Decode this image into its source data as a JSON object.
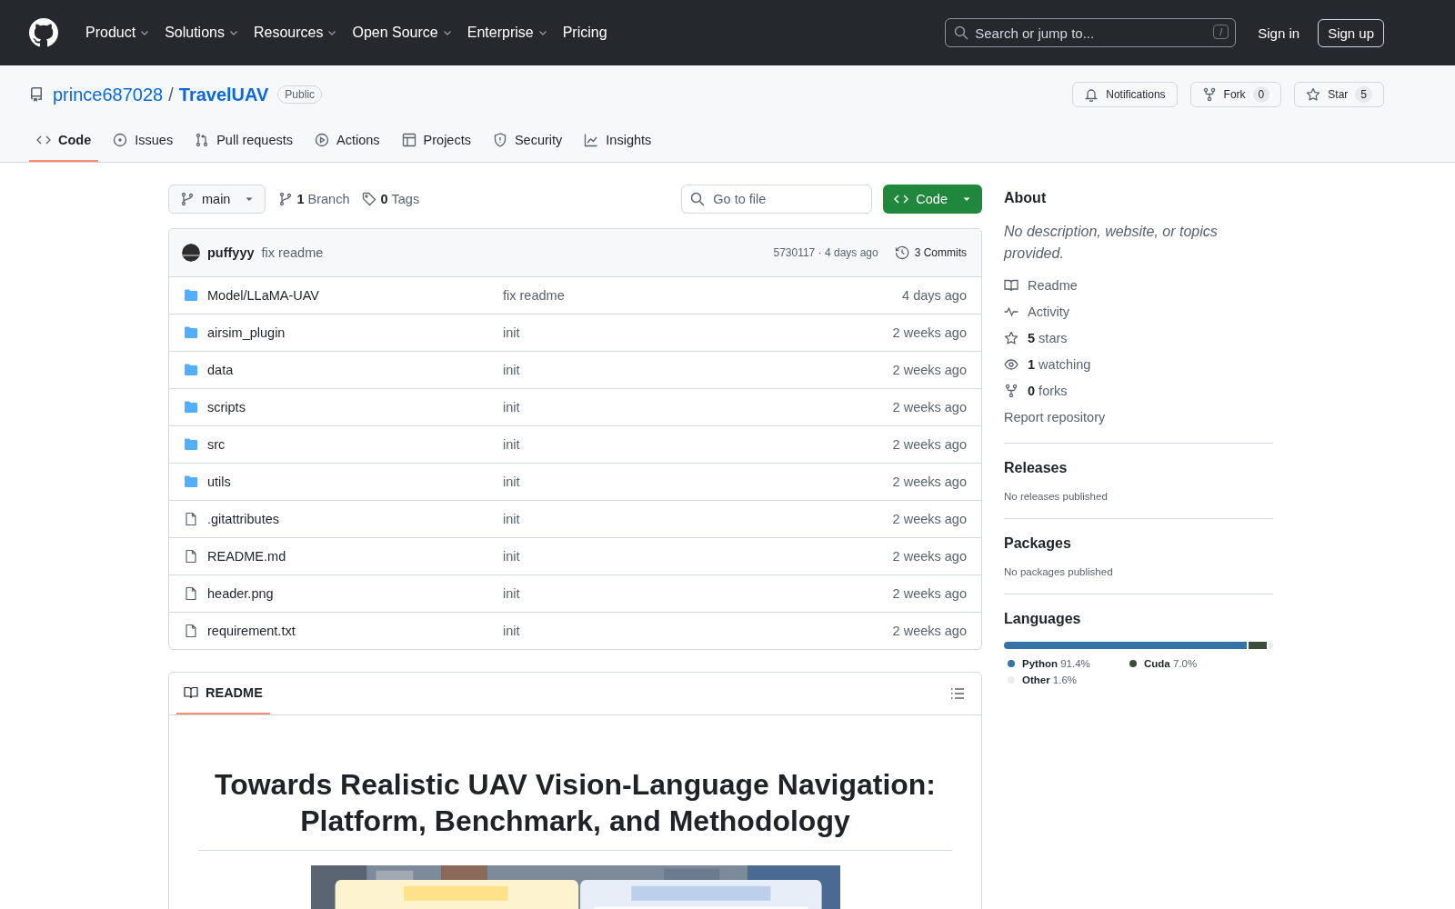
{
  "nav": {
    "items": [
      {
        "label": "Product",
        "dropdown": true
      },
      {
        "label": "Solutions",
        "dropdown": true
      },
      {
        "label": "Resources",
        "dropdown": true
      },
      {
        "label": "Open Source",
        "dropdown": true
      },
      {
        "label": "Enterprise",
        "dropdown": true
      },
      {
        "label": "Pricing",
        "dropdown": false
      }
    ],
    "search": {
      "placeholder": "Search or jump to...",
      "shortcut": "/"
    },
    "sign_in": "Sign in",
    "sign_up": "Sign up"
  },
  "repo": {
    "owner": "prince687028",
    "separator": "/",
    "name": "TravelUAV",
    "visibility": "Public",
    "actions": [
      {
        "kind": "notifications",
        "label": "Notifications"
      },
      {
        "kind": "fork",
        "label": "Fork",
        "count": "0"
      },
      {
        "kind": "star",
        "label": "Star",
        "count": "5"
      }
    ]
  },
  "tabs": [
    {
      "kind": "code",
      "label": "Code",
      "selected": true
    },
    {
      "kind": "issues",
      "label": "Issues",
      "selected": false
    },
    {
      "kind": "pulls",
      "label": "Pull requests",
      "selected": false
    },
    {
      "kind": "actions",
      "label": "Actions",
      "selected": false
    },
    {
      "kind": "projects",
      "label": "Projects",
      "selected": false
    },
    {
      "kind": "security",
      "label": "Security",
      "selected": false
    },
    {
      "kind": "insights",
      "label": "Insights",
      "selected": false
    }
  ],
  "toolbar": {
    "branch": "main",
    "branches": {
      "count": "1",
      "label": "Branch"
    },
    "tags": {
      "count": "0",
      "label": "Tags"
    },
    "go_to_file": {
      "placeholder": "Go to file"
    },
    "code_button": "Code"
  },
  "latest_commit": {
    "author": "puffyyy",
    "message": "fix readme",
    "hash_time": "5730117 · 4 days ago",
    "commits": "3 Commits"
  },
  "files": [
    {
      "kind": "folder",
      "name": "Model/LLaMA-UAV",
      "message": "fix readme",
      "time": "4 days ago"
    },
    {
      "kind": "folder",
      "name": "airsim_plugin",
      "message": "init",
      "time": "2 weeks ago"
    },
    {
      "kind": "folder",
      "name": "data",
      "message": "init",
      "time": "2 weeks ago"
    },
    {
      "kind": "folder",
      "name": "scripts",
      "message": "init",
      "time": "2 weeks ago"
    },
    {
      "kind": "folder",
      "name": "src",
      "message": "init",
      "time": "2 weeks ago"
    },
    {
      "kind": "folder",
      "name": "utils",
      "message": "init",
      "time": "2 weeks ago"
    },
    {
      "kind": "file",
      "name": ".gitattributes",
      "message": "init",
      "time": "2 weeks ago"
    },
    {
      "kind": "file",
      "name": "README.md",
      "message": "init",
      "time": "2 weeks ago"
    },
    {
      "kind": "file",
      "name": "header.png",
      "message": "init",
      "time": "2 weeks ago"
    },
    {
      "kind": "file",
      "name": "requirement.txt",
      "message": "init",
      "time": "2 weeks ago"
    }
  ],
  "readme": {
    "tab": "README",
    "title": "Towards Realistic UAV Vision-Language Navigation: Platform, Benchmark, and Methodology"
  },
  "about": {
    "heading": "About",
    "description": "No description, website, or topics provided.",
    "links": [
      {
        "kind": "readme",
        "label": "Readme"
      },
      {
        "kind": "activity",
        "label": "Activity"
      },
      {
        "kind": "stars",
        "count": "5",
        "label": "stars"
      },
      {
        "kind": "watching",
        "count": "1",
        "label": "watching"
      },
      {
        "kind": "forks",
        "count": "0",
        "label": "forks"
      }
    ],
    "report": "Report repository"
  },
  "releases": {
    "heading": "Releases",
    "note": "No releases published"
  },
  "packages": {
    "heading": "Packages",
    "note": "No packages published"
  },
  "languages": {
    "heading": "Languages",
    "items": [
      {
        "name": "Python",
        "percent": "91.4%",
        "color": "#3572a5"
      },
      {
        "name": "Cuda",
        "percent": "7.0%",
        "color": "#3a4e3a"
      },
      {
        "name": "Other",
        "percent": "1.6%",
        "color": "#ededed"
      }
    ]
  }
}
